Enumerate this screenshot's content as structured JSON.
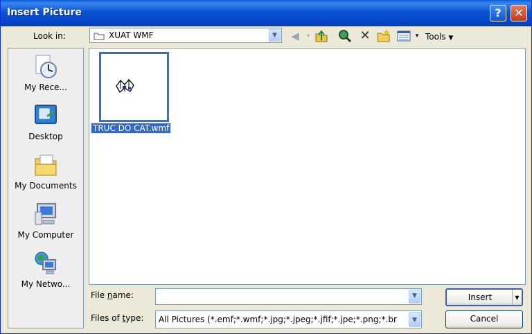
{
  "window": {
    "title": "Insert Picture"
  },
  "lookin": {
    "label": "Look in:",
    "value": "XUAT WMF"
  },
  "toolbar": {
    "tools_label": "Tools"
  },
  "places": [
    {
      "label": "My Rece...",
      "icon": "recent-documents-icon"
    },
    {
      "label": "Desktop",
      "icon": "desktop-icon"
    },
    {
      "label": "My Documents",
      "icon": "my-documents-icon"
    },
    {
      "label": "My Computer",
      "icon": "my-computer-icon"
    },
    {
      "label": "My Netwo...",
      "icon": "my-network-icon"
    }
  ],
  "files": [
    {
      "name": "TRUC DO CAT.wmf",
      "selected": true
    }
  ],
  "filename": {
    "label": "File name:",
    "value": ""
  },
  "filetype": {
    "label": "Files of type:",
    "value": "All Pictures (*.emf;*.wmf;*.jpg;*.jpeg;*.jfif;*.jpe;*.png;*.br"
  },
  "buttons": {
    "insert": "Insert",
    "cancel": "Cancel"
  },
  "colors": {
    "titlebar": "#0a55d4",
    "selection": "#316ac5",
    "dialog": "#ece9d8"
  }
}
